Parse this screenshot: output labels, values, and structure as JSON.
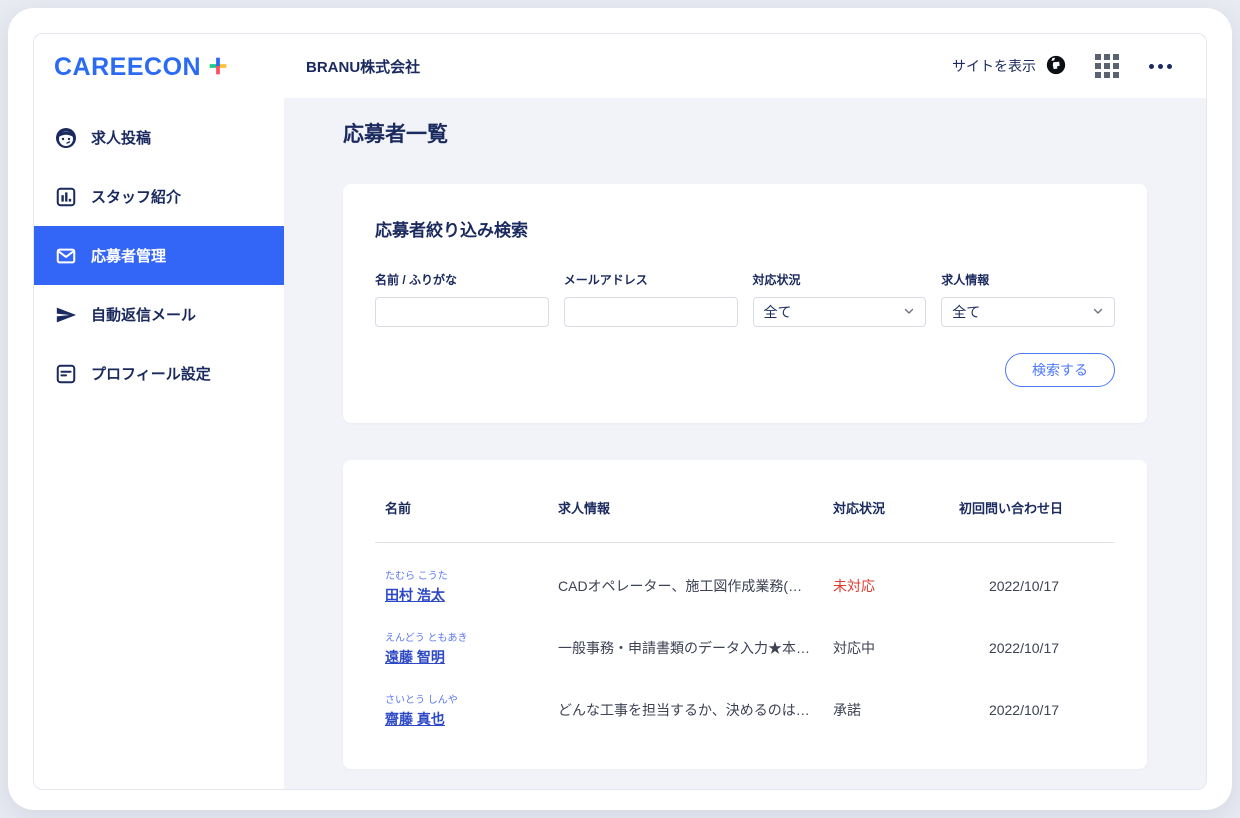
{
  "brand": {
    "logo_text": "CAREECON",
    "plus_colors": {
      "top": "#2f68f6",
      "bottom": "#ff4d67",
      "left": "#1fc98c",
      "right": "#ffc233"
    }
  },
  "header": {
    "company": "BRANU株式会社",
    "view_site_label": "サイトを表示"
  },
  "icons": {
    "topbar": [
      "globe-icon",
      "app-grid-icon",
      "ellipsis-icon"
    ],
    "sidebar": [
      "face-icon",
      "bar-chart-icon",
      "mail-icon",
      "paper-plane-icon",
      "document-icon"
    ]
  },
  "sidebar": {
    "items": [
      {
        "label": "求人投稿",
        "icon": "face-icon",
        "active": false
      },
      {
        "label": "スタッフ紹介",
        "icon": "bar-chart-icon",
        "active": false
      },
      {
        "label": "応募者管理",
        "icon": "mail-icon",
        "active": true
      },
      {
        "label": "自動返信メール",
        "icon": "paper-plane-icon",
        "active": false
      },
      {
        "label": "プロフィール設定",
        "icon": "document-icon",
        "active": false
      }
    ]
  },
  "page": {
    "title": "応募者一覧"
  },
  "search": {
    "title": "応募者絞り込み検索",
    "fields": [
      {
        "label": "名前 / ふりがな",
        "type": "text",
        "value": ""
      },
      {
        "label": "メールアドレス",
        "type": "text",
        "value": ""
      },
      {
        "label": "対応状況",
        "type": "select",
        "value": "全て"
      },
      {
        "label": "求人情報",
        "type": "select",
        "value": "全て"
      }
    ],
    "submit_label": "検索する"
  },
  "table": {
    "headers": [
      "名前",
      "求人情報",
      "対応状況",
      "初回問い合わせ日"
    ],
    "rows": [
      {
        "furigana": "たむら こうた",
        "name": "田村 浩太",
        "job": "CADオペレーター、施工図作成業務(…",
        "status": "未対応",
        "status_color": "#dd3b2f",
        "date": "2022/10/17"
      },
      {
        "furigana": "えんどう ともあき",
        "name": "遠藤 智明",
        "job": "一般事務・申請書類のデータ入力★本…",
        "status": "対応中",
        "status_color": "#3d4254",
        "date": "2022/10/17"
      },
      {
        "furigana": "さいとう しんや",
        "name": "齋藤 真也",
        "job": "どんな工事を担当するか、決めるのは…",
        "status": "承諾",
        "status_color": "#3d4254",
        "date": "2022/10/17"
      }
    ]
  },
  "colors": {
    "accent_blue": "#3365f6",
    "logo_blue": "#2b6bf3",
    "navy_text": "#1b2a5e",
    "link_blue": "#2d49c6",
    "furigana_blue": "#5b78f0",
    "status_red": "#dd3b2f",
    "content_bg": "#f1f3f8",
    "button_blue": "#4c7af9"
  }
}
